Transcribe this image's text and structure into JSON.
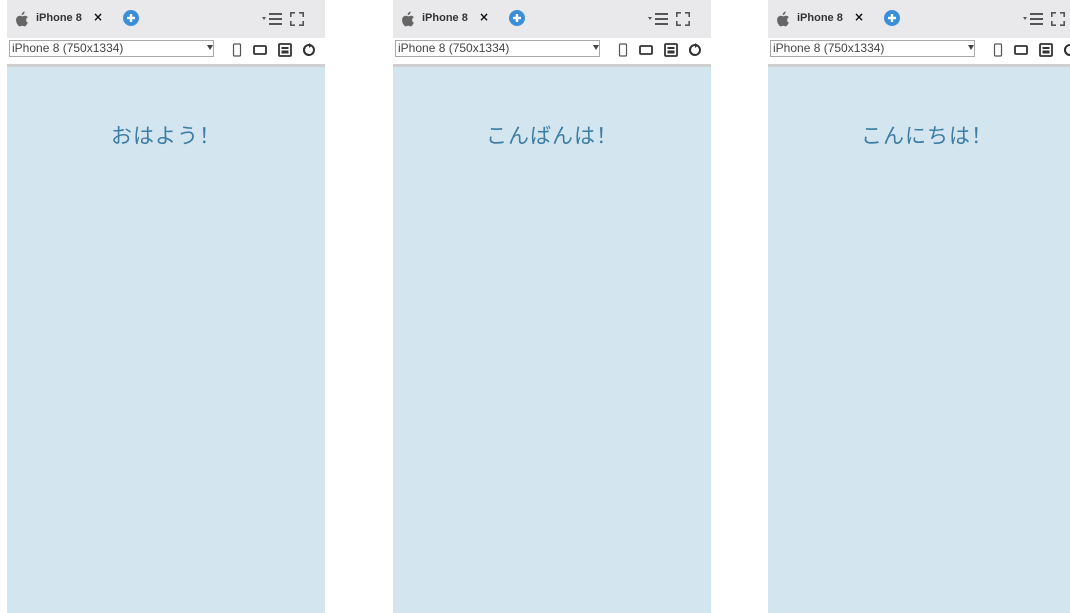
{
  "accent_color": "#3b8fd9",
  "viewport_color": "#d3e5ef",
  "greeting_color": "#3f7ea4",
  "panels": [
    {
      "tab_label": "iPhone 8",
      "close_glyph": "×",
      "device_option": "iPhone 8 (750x1334)",
      "greeting": "おはよう！"
    },
    {
      "tab_label": "iPhone 8",
      "close_glyph": "×",
      "device_option": "iPhone 8 (750x1334)",
      "greeting": "こんばんは！"
    },
    {
      "tab_label": "iPhone 8",
      "close_glyph": "×",
      "device_option": "iPhone 8 (750x1334)",
      "greeting": "こんにちは！"
    }
  ],
  "icons": {
    "tab_icon": "apple-icon",
    "add": "add-tab-icon",
    "menu": "menu-icon",
    "expand": "expand-icon",
    "portrait": "portrait-icon",
    "landscape": "landscape-icon",
    "screenshot": "screenshot-icon",
    "rotate": "rotate-icon"
  }
}
